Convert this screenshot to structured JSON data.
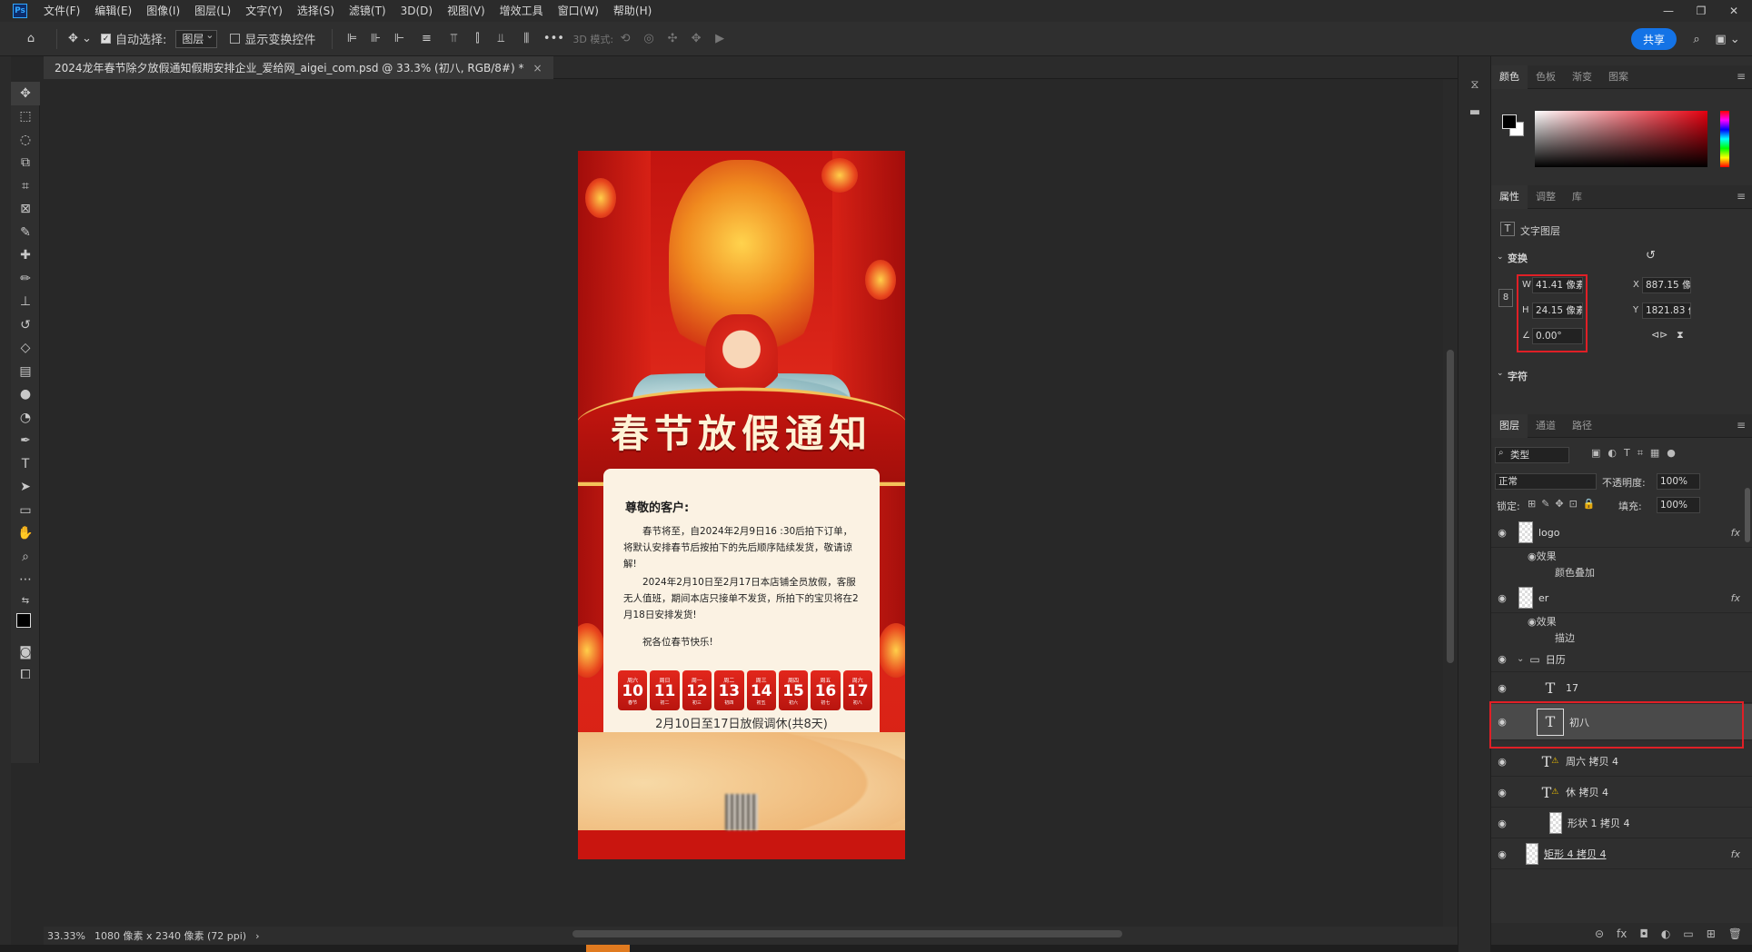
{
  "app": {
    "logo": "Ps"
  },
  "menu": [
    "文件(F)",
    "编辑(E)",
    "图像(I)",
    "图层(L)",
    "文字(Y)",
    "选择(S)",
    "滤镜(T)",
    "3D(D)",
    "视图(V)",
    "增效工具",
    "窗口(W)",
    "帮助(H)"
  ],
  "window_controls": {
    "minimize": "—",
    "restore": "❐",
    "close": "✕"
  },
  "options": {
    "auto_select_label": "自动选择:",
    "auto_select_value": "图层",
    "show_transform_label": "显示变换控件",
    "three_d_mode_label": "3D 模式:",
    "more_label": "•••",
    "share_label": "共享"
  },
  "document": {
    "tab_title": "2024龙年春节除夕放假通知假期安排企业_爱给网_aigei_com.psd @ 33.3% (初八, RGB/8#) *",
    "close_glyph": "×",
    "zoom": "33.33%",
    "dimensions": "1080 像素 x 2340 像素 (72 ppi)",
    "status_arrow": "›"
  },
  "poster": {
    "banner": "春节放假通知",
    "greeting": "尊敬的客户:",
    "para1": "春节将至，自2024年2月9日16 :30后拍下订单，将默认安排春节后按拍下的先后顺序陆续发货，敬请谅解!",
    "para2": "2024年2月10日至2月17日本店铺全员放假，客服无人值班，期间本店只接单不发货，所拍下的宝贝将在2月18日安排发货!",
    "para3": "祝各位春节快乐!",
    "dates": [
      {
        "week": "周六",
        "num": "10",
        "lunar": "春节"
      },
      {
        "week": "周日",
        "num": "11",
        "lunar": "初二"
      },
      {
        "week": "周一",
        "num": "12",
        "lunar": "初三"
      },
      {
        "week": "周二",
        "num": "13",
        "lunar": "初四"
      },
      {
        "week": "周三",
        "num": "14",
        "lunar": "初五"
      },
      {
        "week": "周四",
        "num": "15",
        "lunar": "初六"
      },
      {
        "week": "周五",
        "num": "16",
        "lunar": "初七"
      },
      {
        "week": "周六",
        "num": "17",
        "lunar": "初八"
      }
    ],
    "summary": "2月10日至17日放假调休(共8天)"
  },
  "color_panel": {
    "tabs": [
      "颜色",
      "色板",
      "渐变",
      "图案"
    ]
  },
  "props_panel": {
    "tabs": [
      "属性",
      "调整",
      "库"
    ],
    "layer_type": "文字图层",
    "transform_label": "变换",
    "w_label": "W",
    "w_value": "41.41 像素",
    "h_label": "H",
    "h_value": "24.15 像素",
    "x_label": "X",
    "x_value": "887.15 像素",
    "y_label": "Y",
    "y_value": "1821.83 像",
    "angle_value": "0.00°",
    "char_label": "字符"
  },
  "layers_panel": {
    "tabs": [
      "图层",
      "通道",
      "路径"
    ],
    "filter_value": "类型",
    "blend_mode": "正常",
    "opacity_label": "不透明度:",
    "opacity_value": "100%",
    "lock_label": "锁定:",
    "fill_label": "填充:",
    "fill_value": "100%",
    "layers": [
      {
        "name": "logo",
        "kind": "raster",
        "fx": "fx"
      },
      {
        "name": "er",
        "kind": "raster",
        "fx": "fx"
      },
      {
        "name": "日历",
        "kind": "group"
      },
      {
        "name": "17",
        "kind": "text"
      },
      {
        "name": "初八",
        "kind": "text",
        "selected": true
      },
      {
        "name": "周六 拷贝 4",
        "kind": "text-warn"
      },
      {
        "name": "休 拷贝 4",
        "kind": "text-warn"
      },
      {
        "name": "形状 1 拷贝 4",
        "kind": "shape"
      },
      {
        "name": "矩形 4 拷贝 4",
        "kind": "shape",
        "fx": "fx"
      }
    ],
    "effects_label": "效果",
    "effect_color_overlay": "颜色叠加",
    "effect_stroke": "描边"
  },
  "colors": {
    "accent": "#1473e6",
    "highlight": "#e01f26",
    "poster_red": "#d51f14"
  }
}
